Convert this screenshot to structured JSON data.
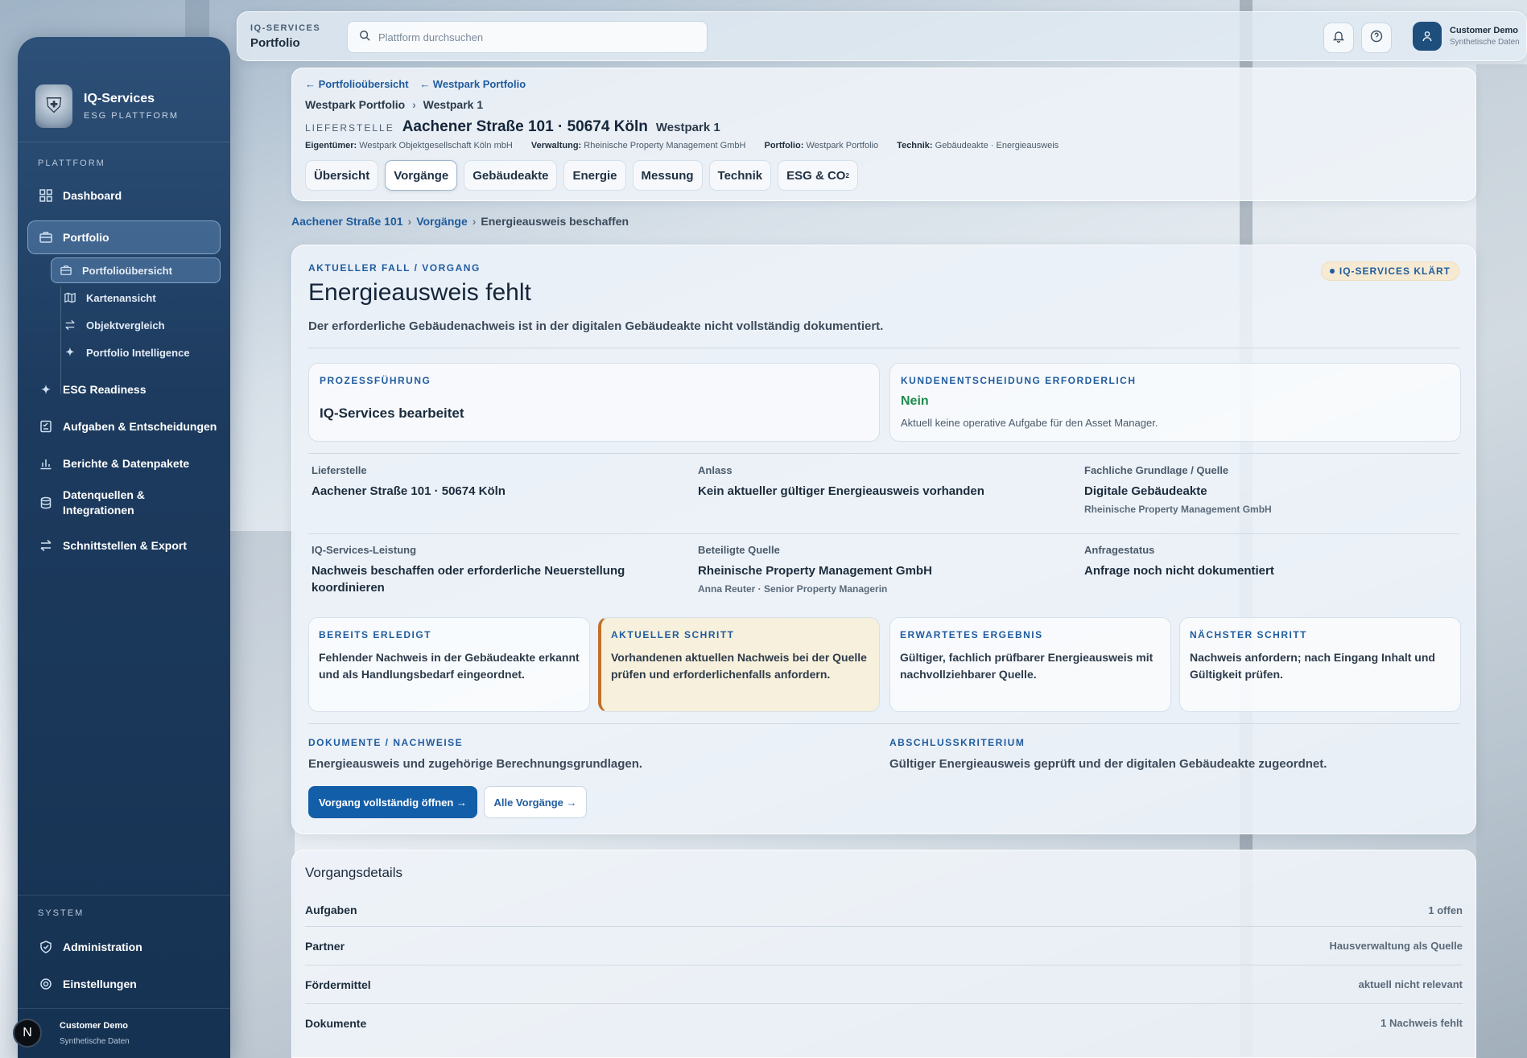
{
  "app": {
    "name": "IQ-Services",
    "sub": "ESG PLATTFORM"
  },
  "sidebar": {
    "section_platform": "PLATTFORM",
    "items": [
      {
        "label": "Dashboard",
        "icon": "grid-icon"
      },
      {
        "label": "Portfolio",
        "icon": "briefcase-icon"
      },
      {
        "label": "ESG Readiness",
        "icon": "sparkle-icon"
      },
      {
        "label": "Aufgaben & Entscheidungen",
        "icon": "checklist-icon"
      },
      {
        "label": "Berichte & Datenpakete",
        "icon": "bar-chart-icon"
      },
      {
        "label": "Datenquellen & Integrationen",
        "icon": "database-icon"
      },
      {
        "label": "Schnittstellen & Export",
        "icon": "arrows-icon"
      }
    ],
    "sub_items": [
      {
        "label": "Portfolioübersicht",
        "icon": "briefcase-icon"
      },
      {
        "label": "Kartenansicht",
        "icon": "map-icon"
      },
      {
        "label": "Objektvergleich",
        "icon": "compare-icon"
      },
      {
        "label": "Portfolio Intelligence",
        "icon": "sparkle-icon"
      }
    ],
    "section_system": "SYSTEM",
    "system_items": [
      {
        "label": "Administration",
        "icon": "shield-icon"
      },
      {
        "label": "Einstellungen",
        "icon": "gear-icon"
      }
    ],
    "footer": {
      "name": "Customer Demo",
      "sub": "Synthetische Daten",
      "badge": "N"
    }
  },
  "topbar": {
    "kicker": "IQ-SERVICES",
    "title": "Portfolio",
    "search_placeholder": "Plattform durchsuchen",
    "user_name": "Customer Demo",
    "user_sub": "Synthetische Daten"
  },
  "header": {
    "back1": "← Portfolioübersicht",
    "back2": "← Westpark Portfolio",
    "crumb1": "Westpark Portfolio",
    "crumb2": "Westpark 1",
    "label": "LIEFERSTELLE",
    "title": "Aachener Straße 101 · 50674 Köln",
    "title2": "Westpark 1",
    "meta": [
      {
        "k": "Eigentümer:",
        "v": "Westpark Objektgesellschaft Köln mbH"
      },
      {
        "k": "Verwaltung:",
        "v": "Rheinische Property Management GmbH"
      },
      {
        "k": "Portfolio:",
        "v": "Westpark Portfolio"
      },
      {
        "k": "Technik:",
        "v": "Gebäudeakte · Energieausweis"
      }
    ],
    "tabs": [
      "Übersicht",
      "Vorgänge",
      "Gebäudeakte",
      "Energie",
      "Messung",
      "Technik",
      "ESG & CO"
    ],
    "tab_sub": "2"
  },
  "path": {
    "p1": "Aachener Straße 101",
    "p2": "Vorgänge",
    "p3": "Energieausweis beschaffen"
  },
  "case": {
    "kicker": "AKTUELLER FALL / VORGANG",
    "pill": "IQ-SERVICES KLÄRT",
    "title": "Energieausweis fehlt",
    "desc": "Der erforderliche Gebäudenachweis ist in der digitalen Gebäudeakte nicht vollständig dokumentiert.",
    "proc_kicker": "PROZESSFÜHRUNG",
    "proc_val": "IQ-Services bearbeitet",
    "dec_kicker": "KUNDENENTSCHEIDUNG ERFORDERLICH",
    "dec_val": "Nein",
    "dec_sub": "Aktuell keine operative Aufgabe für den Asset Manager.",
    "fields": [
      {
        "lab": "Lieferstelle",
        "val": "Aachener Straße 101 · 50674 Köln",
        "sub": ""
      },
      {
        "lab": "Anlass",
        "val": "Kein aktueller gültiger Energieausweis vorhanden",
        "sub": ""
      },
      {
        "lab": "Fachliche Grundlage / Quelle",
        "val": "Digitale Gebäudeakte",
        "sub": "Rheinische Property Management GmbH"
      },
      {
        "lab": "IQ-Services-Leistung",
        "val": "Nachweis beschaffen oder erforderliche Neuerstellung koordinieren",
        "sub": ""
      },
      {
        "lab": "Beteiligte Quelle",
        "val": "Rheinische Property Management GmbH",
        "sub": "Anna Reuter · Senior Property Managerin"
      },
      {
        "lab": "Anfragestatus",
        "val": "Anfrage noch nicht dokumentiert",
        "sub": ""
      }
    ],
    "steps": [
      {
        "k": "BEREITS ERLEDIGT",
        "t": "Fehlender Nachweis in der Gebäudeakte erkannt und als Handlungsbedarf eingeordnet."
      },
      {
        "k": "AKTUELLER SCHRITT",
        "t": "Vorhandenen aktuellen Nachweis bei der Quelle prüfen und erforderlichenfalls anfordern."
      },
      {
        "k": "ERWARTETES ERGEBNIS",
        "t": "Gültiger, fachlich prüfbarer Energieausweis mit nachvollziehbarer Quelle."
      },
      {
        "k": "NÄCHSTER SCHRITT",
        "t": "Nachweis anfordern; nach Eingang Inhalt und Gültigkeit prüfen."
      }
    ],
    "docs_kicker": "DOKUMENTE / NACHWEISE",
    "docs_val": "Energieausweis und zugehörige Berechnungsgrundlagen.",
    "close_kicker": "ABSCHLUSSKRITERIUM",
    "close_val": "Gültiger Energieausweis geprüft und der digitalen Gebäudeakte zugeordnet.",
    "btn_primary": "Vorgang vollständig öffnen →",
    "btn_secondary": "Alle Vorgänge →"
  },
  "details": {
    "title": "Vorgangsdetails",
    "rows": [
      {
        "k": "Aufgaben",
        "v": "1 offen"
      },
      {
        "k": "Partner",
        "v": "Hausverwaltung als Quelle"
      },
      {
        "k": "Fördermittel",
        "v": "aktuell nicht relevant"
      },
      {
        "k": "Dokumente",
        "v": "1 Nachweis fehlt"
      }
    ]
  },
  "colors": {
    "accent": "#1f5c9e",
    "primary_button": "#135ea8",
    "success": "#1e8a4c",
    "current_step_border": "#c0712a"
  }
}
